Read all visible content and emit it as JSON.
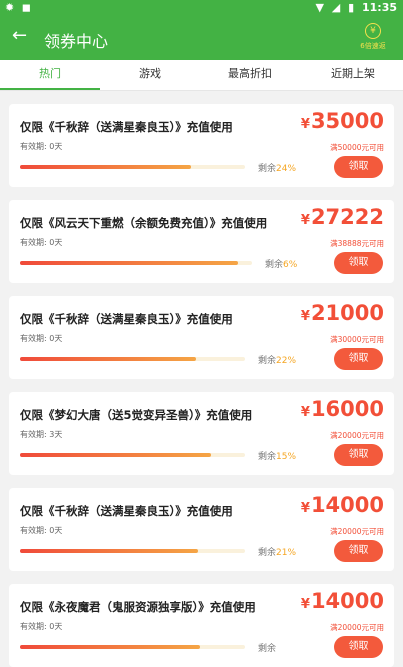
{
  "statusbar": {
    "left_icons": [
      "bug-icon",
      "a-icon"
    ],
    "time": "11:35"
  },
  "header": {
    "back_icon": "←",
    "title": "领券中心",
    "service_label": "6倍速返",
    "service_icon": "¥"
  },
  "tabs": [
    {
      "label": "热门",
      "active": true
    },
    {
      "label": "游戏",
      "active": false
    },
    {
      "label": "最高折扣",
      "active": false
    },
    {
      "label": "近期上架",
      "active": false
    }
  ],
  "coupons": [
    {
      "name": "仅限《千秋辞（送满星秦良玉）》充值使用",
      "validity": "有效期: 0天",
      "currency": "¥",
      "amount": "35000",
      "min_spend": "满50000元可用",
      "remain_label": "剩余",
      "remain_pct": "24%",
      "progress": 0.76,
      "button": "领取"
    },
    {
      "name": "仅限《风云天下重燃（余额免费充值）》充值使用",
      "validity": "有效期: 0天",
      "currency": "¥",
      "amount": "27222",
      "min_spend": "满38888元可用",
      "remain_label": "剩余",
      "remain_pct": "6%",
      "progress": 0.94,
      "button": "领取"
    },
    {
      "name": "仅限《千秋辞（送满星秦良玉）》充值使用",
      "validity": "有效期: 0天",
      "currency": "¥",
      "amount": "21000",
      "min_spend": "满30000元可用",
      "remain_label": "剩余",
      "remain_pct": "22%",
      "progress": 0.78,
      "button": "领取"
    },
    {
      "name": "仅限《梦幻大唐（送5觉变异圣兽）》充值使用",
      "validity": "有效期: 3天",
      "currency": "¥",
      "amount": "16000",
      "min_spend": "满20000元可用",
      "remain_label": "剩余",
      "remain_pct": "15%",
      "progress": 0.85,
      "button": "领取"
    },
    {
      "name": "仅限《千秋辞（送满星秦良玉）》充值使用",
      "validity": "有效期: 0天",
      "currency": "¥",
      "amount": "14000",
      "min_spend": "满20000元可用",
      "remain_label": "剩余",
      "remain_pct": "21%",
      "progress": 0.79,
      "button": "领取"
    },
    {
      "name": "仅限《永夜魔君（鬼服资源独享版）》充值使用",
      "validity": "有效期: 0天",
      "currency": "¥",
      "amount": "14000",
      "min_spend": "满20000元可用",
      "remain_label": "剩余",
      "remain_pct": "",
      "progress": 0.8,
      "button": "领取"
    }
  ],
  "colors": {
    "primary": "#43b244",
    "accent": "#f24f38",
    "button": "#f35a3c",
    "remain_pct": "#f5a623"
  }
}
